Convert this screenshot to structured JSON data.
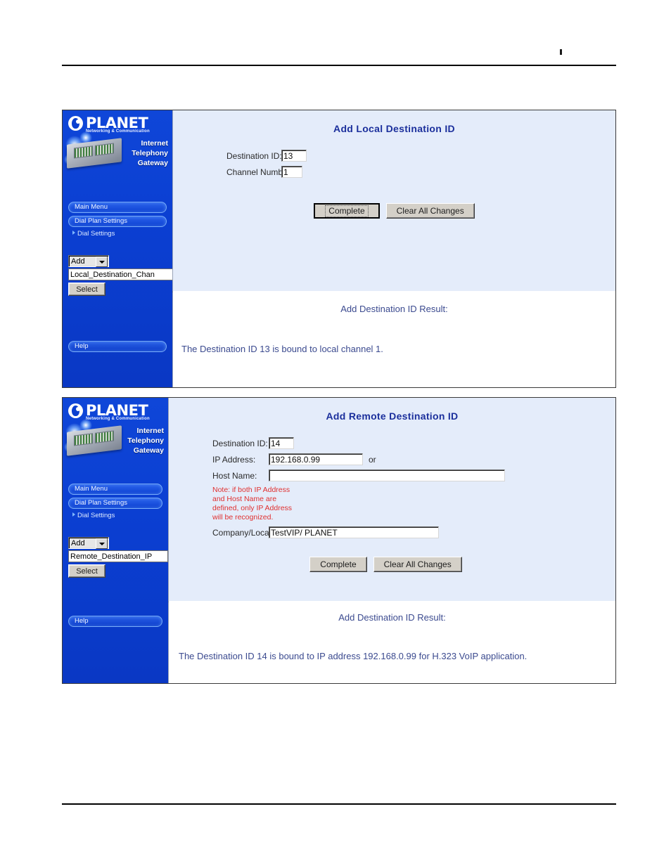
{
  "page": {
    "background": "#ffffff",
    "rule_color": "#000000"
  },
  "brand": {
    "logo_word": "PLANET",
    "logo_tagline": "Networking & Communication",
    "product_line1": "Internet",
    "product_line2": "Telephony",
    "product_line3": "Gateway",
    "sidebar_color": "#0a3fd0",
    "title_color": "#1b2f9c",
    "result_color": "#3b4a8f",
    "note_color": "#e03030"
  },
  "panel_local": {
    "sidebar": {
      "nav_items": [
        {
          "label": "Main Menu"
        },
        {
          "label": "Dial Plan Settings"
        }
      ],
      "sub_item": "Dial Settings",
      "dropdown_value": "Add",
      "list_value": "Local_Destination_Chan",
      "select_button": "Select",
      "help_label": "Help"
    },
    "form": {
      "title": "Add Local Destination ID",
      "fields": [
        {
          "label": "Destination ID:",
          "value": "13"
        },
        {
          "label": "Channel Number:",
          "value": "1"
        }
      ],
      "buttons": [
        {
          "label": "Complete",
          "focused": true
        },
        {
          "label": "Clear All Changes",
          "focused": false
        }
      ]
    },
    "result": {
      "title": "Add Destination ID Result:",
      "text": "The Destination ID 13 is bound to local channel 1."
    }
  },
  "panel_remote": {
    "sidebar": {
      "nav_items": [
        {
          "label": "Main Menu"
        },
        {
          "label": "Dial Plan Settings"
        }
      ],
      "sub_item": "Dial Settings",
      "dropdown_value": "Add",
      "list_value": "Remote_Destination_IP",
      "select_button": "Select",
      "help_label": "Help"
    },
    "form": {
      "title": "Add Remote Destination ID",
      "label_destination_id": "Destination ID:",
      "value_destination_id": "14",
      "label_ip_address": "IP Address:",
      "value_ip_address": "192.168.0.99",
      "or_text": "or",
      "label_host_name": "Host Name:",
      "value_host_name": "",
      "note": "Note: if both IP Address and Host Name are defined, only IP Address will be recognized.",
      "label_company_location": "Company/Location:",
      "value_company_location": "TestVIP/ PLANET",
      "buttons": [
        {
          "label": "Complete",
          "focused": false
        },
        {
          "label": "Clear All Changes",
          "focused": false
        }
      ]
    },
    "result": {
      "title": "Add Destination ID Result:",
      "text": "The Destination ID 14 is bound to IP address 192.168.0.99 for H.323 VoIP application."
    }
  }
}
